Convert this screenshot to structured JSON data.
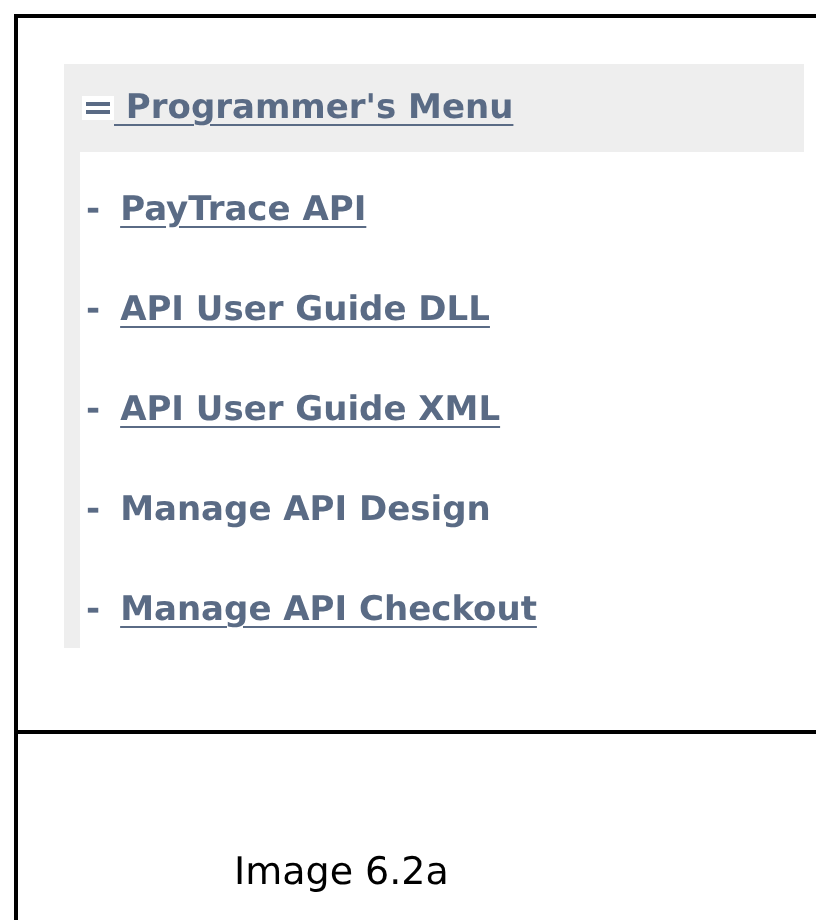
{
  "menu": {
    "title": "Programmer's Menu",
    "items": [
      {
        "marker": "-",
        "label": "PayTrace API",
        "link": true
      },
      {
        "marker": "-",
        "label": "API User Guide DLL",
        "link": true
      },
      {
        "marker": "-",
        "label": "API User Guide XML",
        "link": true
      },
      {
        "marker": "-",
        "label": "Manage API Design",
        "link": false
      },
      {
        "marker": "-",
        "label": "Manage API Checkout",
        "link": true
      }
    ]
  },
  "caption": "Image 6.2a"
}
